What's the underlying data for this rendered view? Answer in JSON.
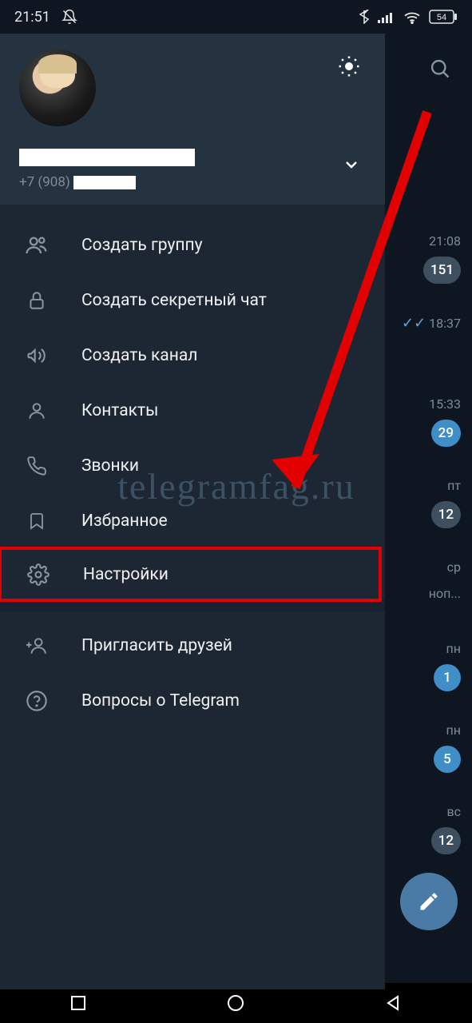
{
  "statusbar": {
    "time": "21:51",
    "battery": "54"
  },
  "drawer": {
    "phone_prefix": "+7 (908)",
    "menu": {
      "create_group": "Создать группу",
      "create_secret_chat": "Создать секретный чат",
      "create_channel": "Создать канал",
      "contacts": "Контакты",
      "calls": "Звонки",
      "saved": "Избранное",
      "settings": "Настройки",
      "invite": "Пригласить друзей",
      "faq": "Вопросы о Telegram"
    }
  },
  "chats": [
    {
      "time": "21:08",
      "badge": "151",
      "badge_type": "muted"
    },
    {
      "time": "18:37",
      "read": true
    },
    {
      "time": "15:33",
      "badge": "29",
      "badge_type": "blue"
    },
    {
      "time": "пт",
      "badge": "12",
      "badge_type": "muted"
    },
    {
      "time": "ср",
      "sub": "ноп..."
    },
    {
      "time": "пн",
      "badge": "1",
      "badge_type": "blue"
    },
    {
      "time": "пн",
      "badge": "5",
      "badge_type": "blue"
    },
    {
      "time": "вс",
      "badge": "12",
      "badge_type": "muted"
    }
  ],
  "watermark": "telegramfag.ru"
}
